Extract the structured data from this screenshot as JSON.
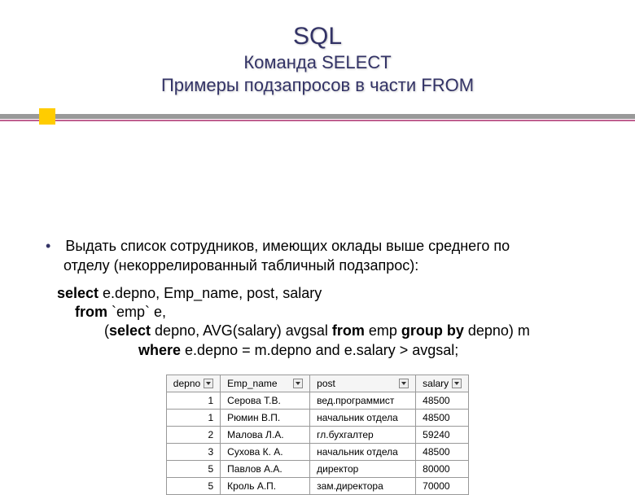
{
  "header": {
    "sql": "SQL",
    "select": "Команда SELECT",
    "subtitle": "Примеры подзапросов в части FROM"
  },
  "body": {
    "bullet": "•",
    "line1": "Выдать список сотрудников, имеющих оклады выше среднего по",
    "line2": "отделу (некоррелированный табличный подзапрос):"
  },
  "code": {
    "l1a": "select",
    "l1b": " e.depno, Emp_name, post, salary",
    "l2a": "from",
    "l2b": " `emp` e,",
    "l3a": "(",
    "l3b": "select",
    "l3c": "  depno, AVG(salary) avgsal ",
    "l3d": "from",
    "l3e": " emp ",
    "l3f": "group by",
    "l3g": " depno) m",
    "l4a": "where",
    "l4b": " e.depno = m.depno and e.salary > avgsal;"
  },
  "table": {
    "headers": {
      "depno": "depno",
      "name": "Emp_name",
      "post": "post",
      "salary": "salary"
    },
    "rows": [
      {
        "depno": "1",
        "name": "Серова Т.В.",
        "post": "вед.программист",
        "salary": "48500"
      },
      {
        "depno": "1",
        "name": "Рюмин В.П.",
        "post": "начальник отдела",
        "salary": "48500"
      },
      {
        "depno": "2",
        "name": "Малова Л.А.",
        "post": "гл.бухгалтер",
        "salary": "59240"
      },
      {
        "depno": "3",
        "name": "Сухова К. А.",
        "post": "начальник отдела",
        "salary": "48500"
      },
      {
        "depno": "5",
        "name": "Павлов А.А.",
        "post": "директор",
        "salary": "80000"
      },
      {
        "depno": "5",
        "name": "Кроль А.П.",
        "post": "зам.директора",
        "salary": "70000"
      }
    ]
  }
}
